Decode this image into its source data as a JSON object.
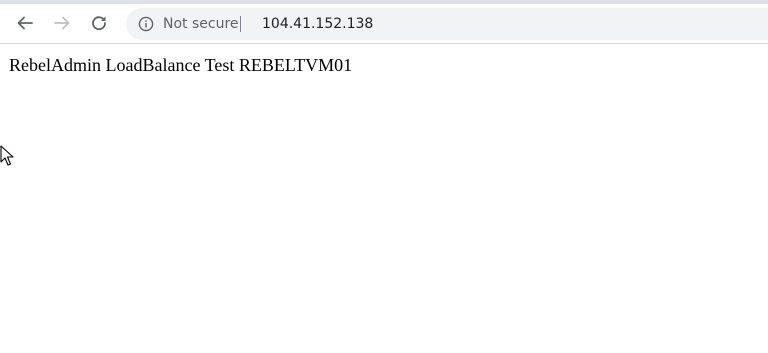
{
  "browser": {
    "security_label": "Not secure",
    "url": "104.41.152.138",
    "icons": {
      "back": "back-arrow-icon",
      "forward": "forward-arrow-icon",
      "reload": "reload-icon",
      "info": "info-icon"
    }
  },
  "page": {
    "text": "RebelAdmin LoadBalance Test REBELTVM01"
  },
  "colors": {
    "omnibox_bg": "#f1f3f4",
    "security_text": "#5f6368",
    "url_text": "#202124",
    "nav_icon_active": "#5f6368",
    "nav_icon_disabled": "#bdc1c6"
  }
}
